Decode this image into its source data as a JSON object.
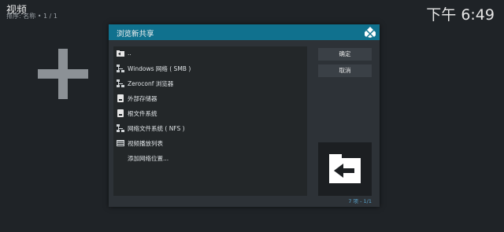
{
  "background": {
    "title": "视频",
    "subtitle": "排序: 名称 • 1 / 1",
    "clock": "下午 6:49"
  },
  "dialog": {
    "title": "浏览新共享",
    "items": [
      {
        "label": "..",
        "icon": "folder-back-icon"
      },
      {
        "label": "Windows 网络 ( SMB )",
        "icon": "network-icon"
      },
      {
        "label": "Zeroconf 浏览器",
        "icon": "network-icon"
      },
      {
        "label": "外部存储器",
        "icon": "removable-drive-icon"
      },
      {
        "label": "根文件系统",
        "icon": "drive-icon"
      },
      {
        "label": "网络文件系统 ( NFS )",
        "icon": "network-icon"
      },
      {
        "label": "视频播放列表",
        "icon": "playlist-icon"
      },
      {
        "label": "添加网络位置...",
        "icon": ""
      }
    ],
    "ok_label": "确定",
    "cancel_label": "取消",
    "count": "7 项 - 1/1"
  },
  "colors": {
    "accent": "#10718e",
    "background": "#1f2327",
    "dialog": "#2d3237"
  }
}
